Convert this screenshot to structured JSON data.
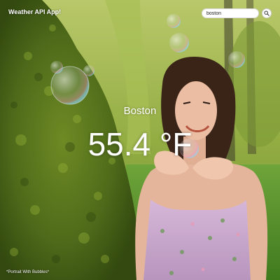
{
  "app": {
    "title": "Weather API App!"
  },
  "search": {
    "value": "boston",
    "placeholder": "",
    "button_icon": "search-icon"
  },
  "weather": {
    "city": "Boston",
    "temperature": "55.4 °F"
  },
  "background": {
    "caption": "*Portrait With Bubbles*",
    "colors": {
      "bush": "#4f6b1c",
      "trees": "#9ab54a",
      "lawn": "#5c8f2c",
      "dress": "#c9a9cf",
      "skin": "#e7b9a0",
      "hair": "#3a2418"
    }
  }
}
